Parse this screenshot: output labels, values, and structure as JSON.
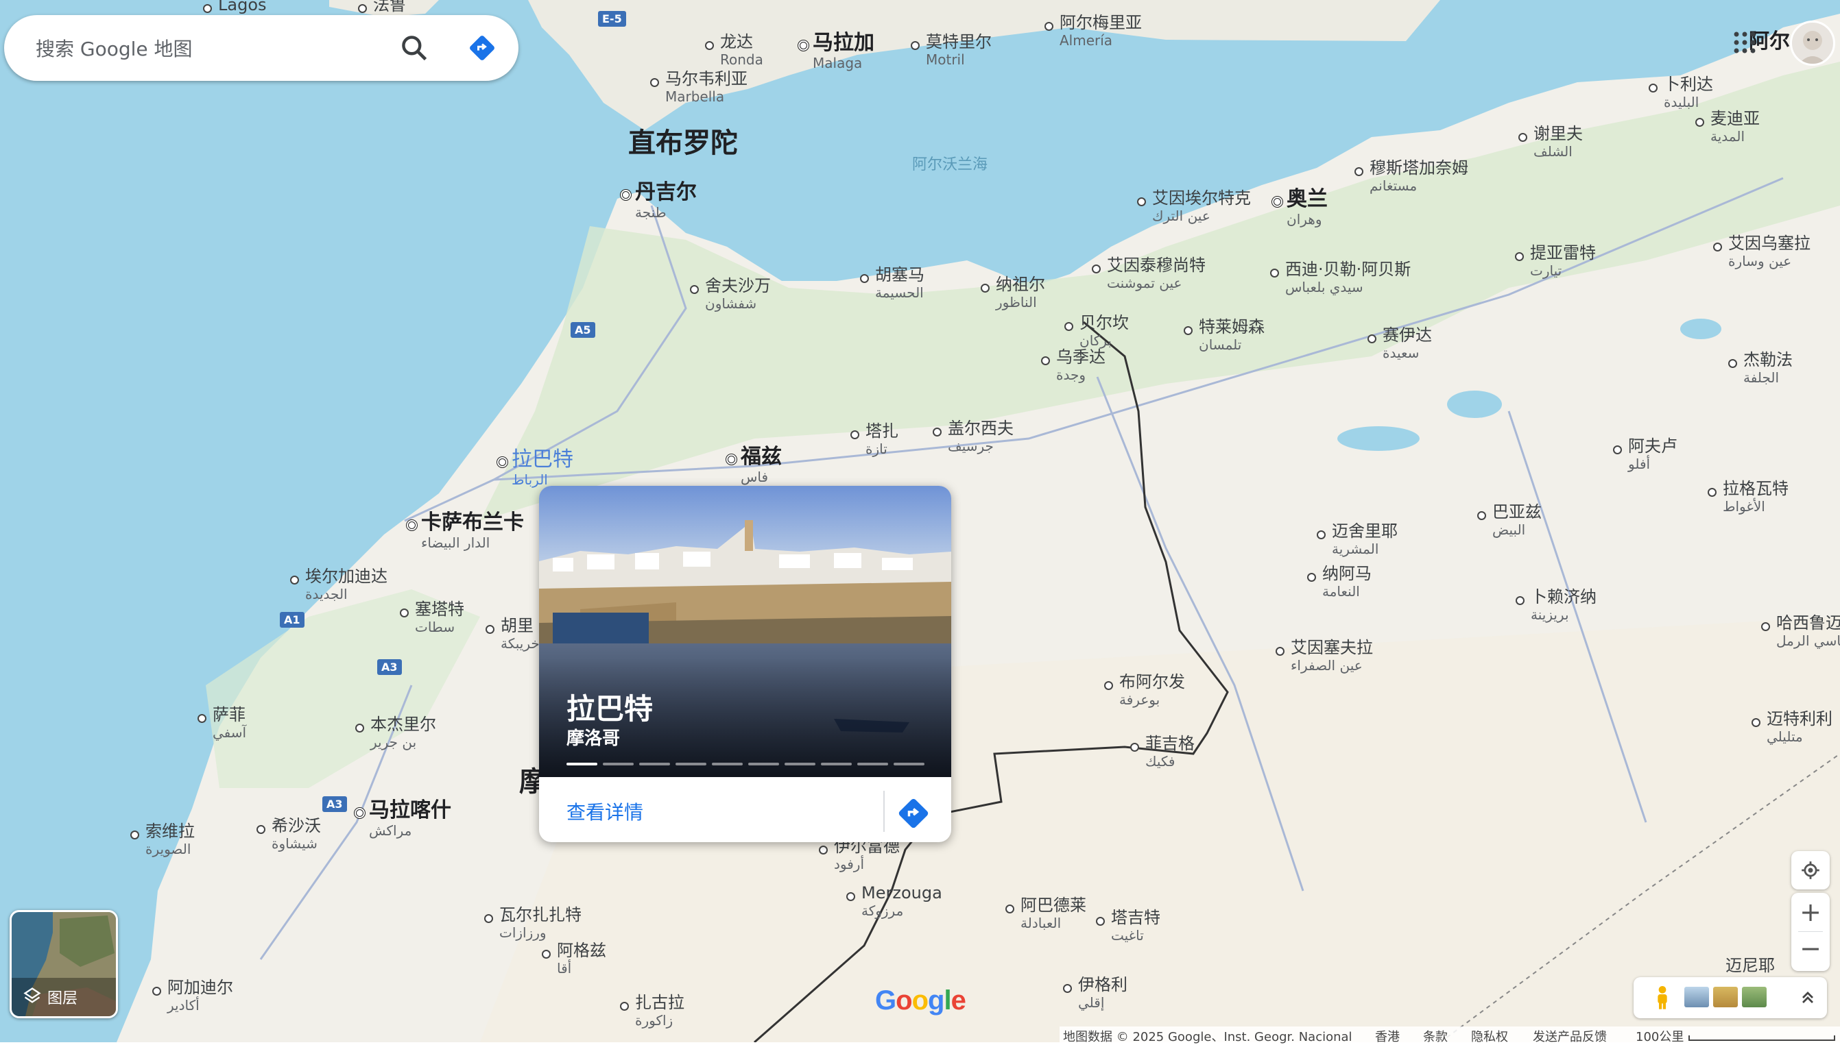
{
  "search": {
    "placeholder": "搜索 Google 地图",
    "search_icon": "search-icon",
    "directions_icon": "directions-icon"
  },
  "map_labels": [
    {
      "id": "lagos",
      "zh": "Lagos",
      "sub": "",
      "cls": ""
    },
    {
      "id": "faro",
      "zh": "法鲁",
      "sub": "",
      "cls": ""
    },
    {
      "id": "ronda",
      "zh": "龙达",
      "sub": "Ronda",
      "cls": ""
    },
    {
      "id": "malaga",
      "zh": "马拉加",
      "sub": "Malaga",
      "cls": "med"
    },
    {
      "id": "motril",
      "zh": "莫特里尔",
      "sub": "Motril",
      "cls": ""
    },
    {
      "id": "almeria",
      "zh": "阿尔梅里亚",
      "sub": "Almería",
      "cls": ""
    },
    {
      "id": "marbella",
      "zh": "马尔韦利亚",
      "sub": "Marbella",
      "cls": ""
    },
    {
      "id": "gibraltar",
      "zh": "直布罗陀",
      "sub": "",
      "cls": "big"
    },
    {
      "id": "alboran",
      "zh": "阿尔沃兰海",
      "sub": "",
      "cls": "sea"
    },
    {
      "id": "tangier",
      "zh": "丹吉尔",
      "sub": "طنجة",
      "cls": "med"
    },
    {
      "id": "chefchaouen",
      "zh": "舍夫沙万",
      "sub": "شفشاون",
      "cls": ""
    },
    {
      "id": "alhoceima",
      "zh": "胡塞马",
      "sub": "الحسيمة",
      "cls": ""
    },
    {
      "id": "nador",
      "zh": "纳祖尔",
      "sub": "الناظور",
      "cls": ""
    },
    {
      "id": "berkane",
      "zh": "贝尔坎",
      "sub": "بركان",
      "cls": ""
    },
    {
      "id": "oujda",
      "zh": "乌季达",
      "sub": "وجدة",
      "cls": ""
    },
    {
      "id": "tlemcen",
      "zh": "特莱姆森",
      "sub": "تلمسان",
      "cls": ""
    },
    {
      "id": "temouchent",
      "zh": "艾因泰穆尚特",
      "sub": "عين تموشنت",
      "cls": ""
    },
    {
      "id": "turk",
      "zh": "艾因埃尔特克",
      "sub": "عين الترك",
      "cls": ""
    },
    {
      "id": "oran",
      "zh": "奥兰",
      "sub": "وهران",
      "cls": "med"
    },
    {
      "id": "sba",
      "zh": "西迪·贝勒·阿贝斯",
      "sub": "سيدي بلعباس",
      "cls": ""
    },
    {
      "id": "saida",
      "zh": "赛伊达",
      "sub": "سعيدة",
      "cls": ""
    },
    {
      "id": "mostaganem",
      "zh": "穆斯塔加奈姆",
      "sub": "مستغانم",
      "cls": ""
    },
    {
      "id": "chlef",
      "zh": "谢里夫",
      "sub": "الشلف",
      "cls": ""
    },
    {
      "id": "tipaza",
      "zh": "卜利达",
      "sub": "البليدة",
      "cls": ""
    },
    {
      "id": "medea",
      "zh": "麦迪亚",
      "sub": "المدية",
      "cls": ""
    },
    {
      "id": "tiaret",
      "zh": "提亚雷特",
      "sub": "تيارت",
      "cls": ""
    },
    {
      "id": "ouessara",
      "zh": "艾因乌塞拉",
      "sub": "عين وسارة",
      "cls": ""
    },
    {
      "id": "djelfa",
      "zh": "杰勒法",
      "sub": "الجلفة",
      "cls": ""
    },
    {
      "id": "aflou",
      "zh": "阿夫卢",
      "sub": "أفلو",
      "cls": ""
    },
    {
      "id": "laghouat",
      "zh": "拉格瓦特",
      "sub": "الأغواط",
      "cls": ""
    },
    {
      "id": "bayadh",
      "zh": "巴亚兹",
      "sub": "البيض",
      "cls": ""
    },
    {
      "id": "mecheria",
      "zh": "迈舍里耶",
      "sub": "المشرية",
      "cls": ""
    },
    {
      "id": "naama",
      "zh": "纳阿马",
      "sub": "النعامة",
      "cls": ""
    },
    {
      "id": "sefra",
      "zh": "艾因塞夫拉",
      "sub": "عين الصفراء",
      "cls": ""
    },
    {
      "id": "brezina",
      "zh": "卜赖济纳",
      "sub": "بريزينة",
      "cls": ""
    },
    {
      "id": "hassirmel",
      "zh": "哈西鲁迈勒",
      "sub": "حاسي الرمل",
      "cls": ""
    },
    {
      "id": "metlili",
      "zh": "迈特利利",
      "sub": "متليلي",
      "cls": ""
    },
    {
      "id": "taza",
      "zh": "塔扎",
      "sub": "تازة",
      "cls": ""
    },
    {
      "id": "guercif",
      "zh": "盖尔西夫",
      "sub": "جرسيف",
      "cls": ""
    },
    {
      "id": "fes",
      "zh": "福兹",
      "sub": "فاس",
      "cls": "med"
    },
    {
      "id": "rabat",
      "zh": "拉巴特",
      "sub": "الرباط",
      "cls": "blue"
    },
    {
      "id": "casablanca",
      "zh": "卡萨布兰卡",
      "sub": "الدار البيضاء",
      "cls": "med"
    },
    {
      "id": "eljadida",
      "zh": "埃尔加迪达",
      "sub": "الجديدة",
      "cls": ""
    },
    {
      "id": "settat",
      "zh": "塞塔特",
      "sub": "سطات",
      "cls": ""
    },
    {
      "id": "khouribga",
      "zh": "胡里",
      "sub": "خريبكة",
      "cls": ""
    },
    {
      "id": "safi",
      "zh": "萨菲",
      "sub": "آسفي",
      "cls": ""
    },
    {
      "id": "benguerir",
      "zh": "本杰里尔",
      "sub": "بن جرير",
      "cls": ""
    },
    {
      "id": "marrakech",
      "zh": "马拉喀什",
      "sub": "مراكش",
      "cls": "med"
    },
    {
      "id": "essaouira",
      "zh": "索维拉",
      "sub": "الصويرة",
      "cls": ""
    },
    {
      "id": "chichaoua",
      "zh": "希沙沃",
      "sub": "شيشاوة",
      "cls": ""
    },
    {
      "id": "ouarzazate",
      "zh": "瓦尔扎扎特",
      "sub": "ورزازات",
      "cls": ""
    },
    {
      "id": "agadir",
      "zh": "阿加迪尔",
      "sub": "أكادير",
      "cls": ""
    },
    {
      "id": "akka",
      "zh": "阿格兹",
      "sub": "أقا",
      "cls": ""
    },
    {
      "id": "zagora",
      "zh": "扎古拉",
      "sub": "زاكورة",
      "cls": ""
    },
    {
      "id": "bouarfa",
      "zh": "布阿尔发",
      "sub": "بوعرفة",
      "cls": ""
    },
    {
      "id": "figuig",
      "zh": "菲吉格",
      "sub": "فكيك",
      "cls": ""
    },
    {
      "id": "erfoud",
      "zh": "伊尔富德",
      "sub": "أرفود",
      "cls": ""
    },
    {
      "id": "merzouga",
      "zh": "Merzouga",
      "sub": "مرزوكة",
      "cls": ""
    },
    {
      "id": "abadla",
      "zh": "阿巴德莱",
      "sub": "العبادلة",
      "cls": ""
    },
    {
      "id": "taghit",
      "zh": "塔吉特",
      "sub": "تاغيت",
      "cls": ""
    },
    {
      "id": "igli",
      "zh": "伊格利",
      "sub": "إقلي",
      "cls": ""
    },
    {
      "id": "elnirer",
      "zh": "迈尼耶",
      "sub": "",
      "cls": ""
    },
    {
      "id": "algiers",
      "zh": "阿尔",
      "sub": "",
      "cls": "med"
    },
    {
      "id": "morocco",
      "zh": "摩",
      "sub": "",
      "cls": "big"
    }
  ],
  "card": {
    "title": "拉巴特",
    "subtitle": "摩洛哥",
    "details_link": "查看详情",
    "photo_count": 10,
    "photo_index": 1
  },
  "controls": {
    "layers_label": "图层",
    "zoom_in": "+",
    "zoom_out": "−"
  },
  "road_shields": [
    "E-5",
    "A5",
    "A1",
    "A3",
    "A3"
  ],
  "footer": {
    "data": "地图数据 © 2025 Google、Inst. Geogr. Nacional",
    "region": "香港",
    "terms": "条款",
    "privacy": "隐私权",
    "feedback": "发送产品反馈",
    "scale": "100公里"
  },
  "logo": "Google",
  "colors": {
    "sea": "#9fd3e8",
    "land": "#f2f0ea",
    "green": "#c8e6c0",
    "accent": "#1a73e8"
  }
}
